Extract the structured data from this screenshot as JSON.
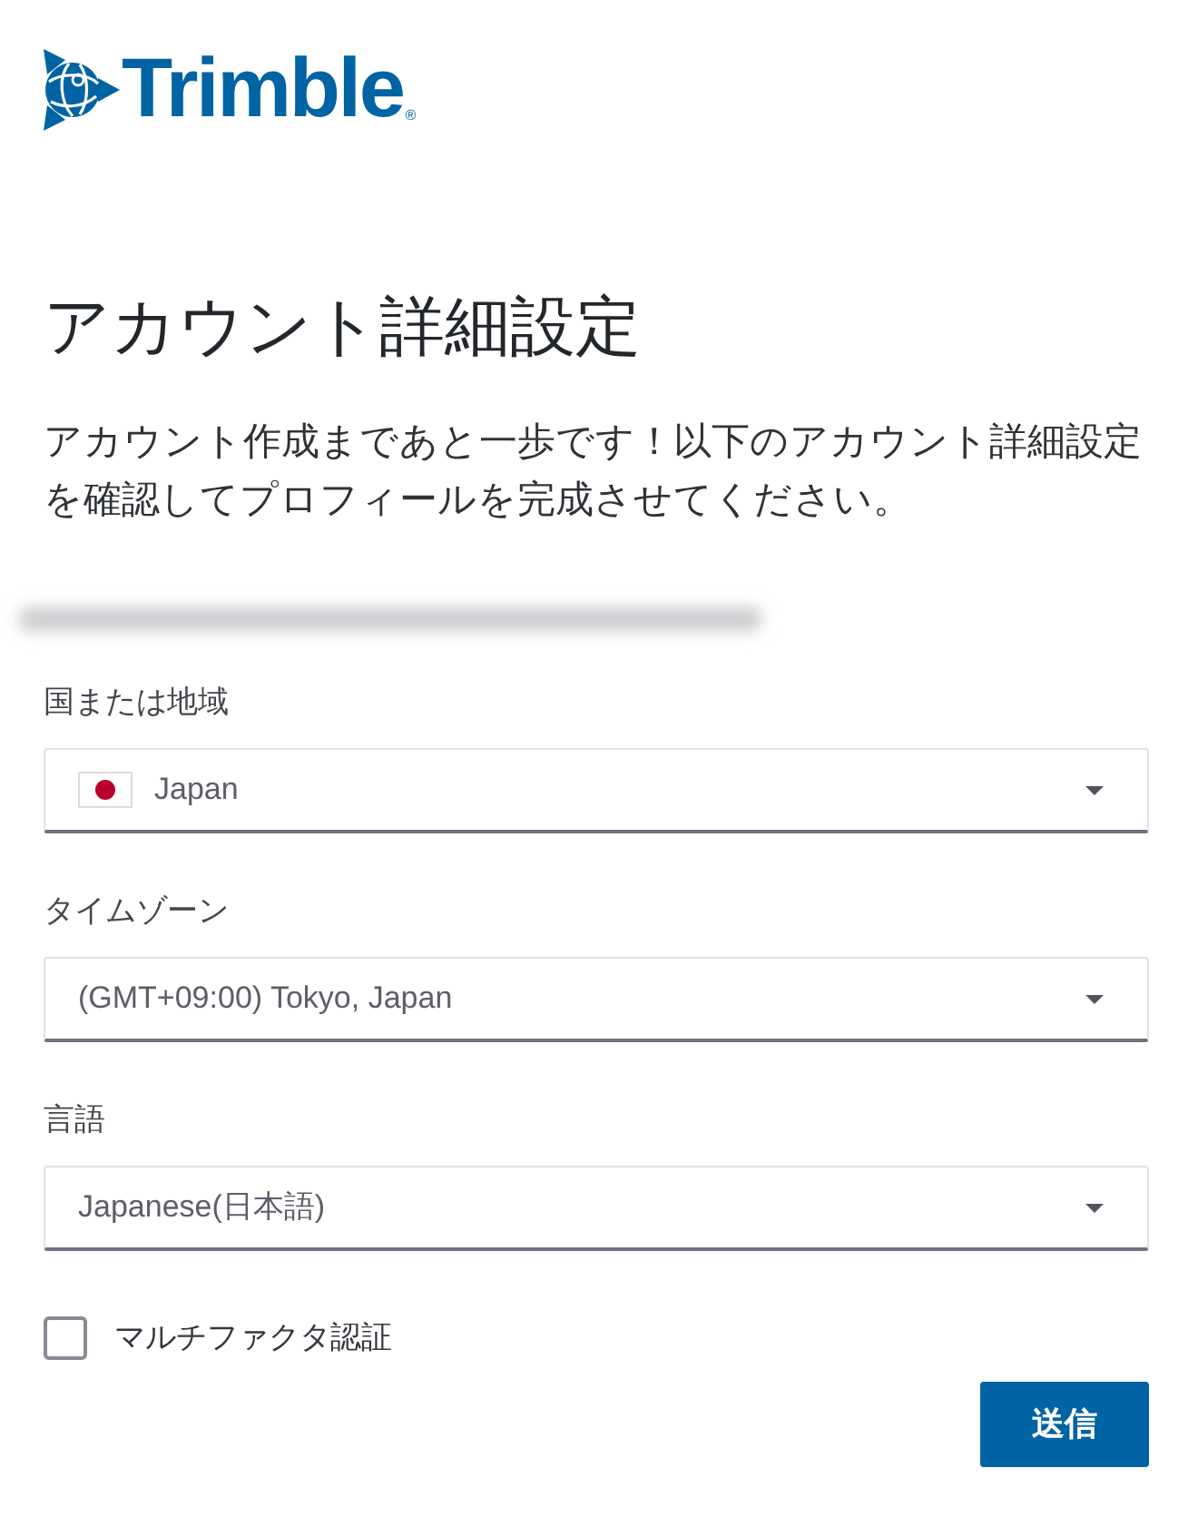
{
  "logo": {
    "text": "Trimble",
    "mark": "®"
  },
  "heading": "アカウント詳細設定",
  "intro": "アカウント作成まであと一歩です！以下のアカウント詳細設定を確認してプロフィールを完成させてください。",
  "account_email": {
    "blurred": true
  },
  "fields": [
    {
      "kind": "country",
      "label": "国または地域",
      "value": "Japan"
    },
    {
      "kind": "select",
      "label": "タイムゾーン",
      "value": "(GMT+09:00) Tokyo, Japan"
    },
    {
      "kind": "select",
      "label": "言語",
      "value": "Japanese(日本語)"
    }
  ],
  "mfa": {
    "label": "マルチファクタ認証",
    "checked": false
  },
  "submit_button": {
    "label": "送信"
  }
}
